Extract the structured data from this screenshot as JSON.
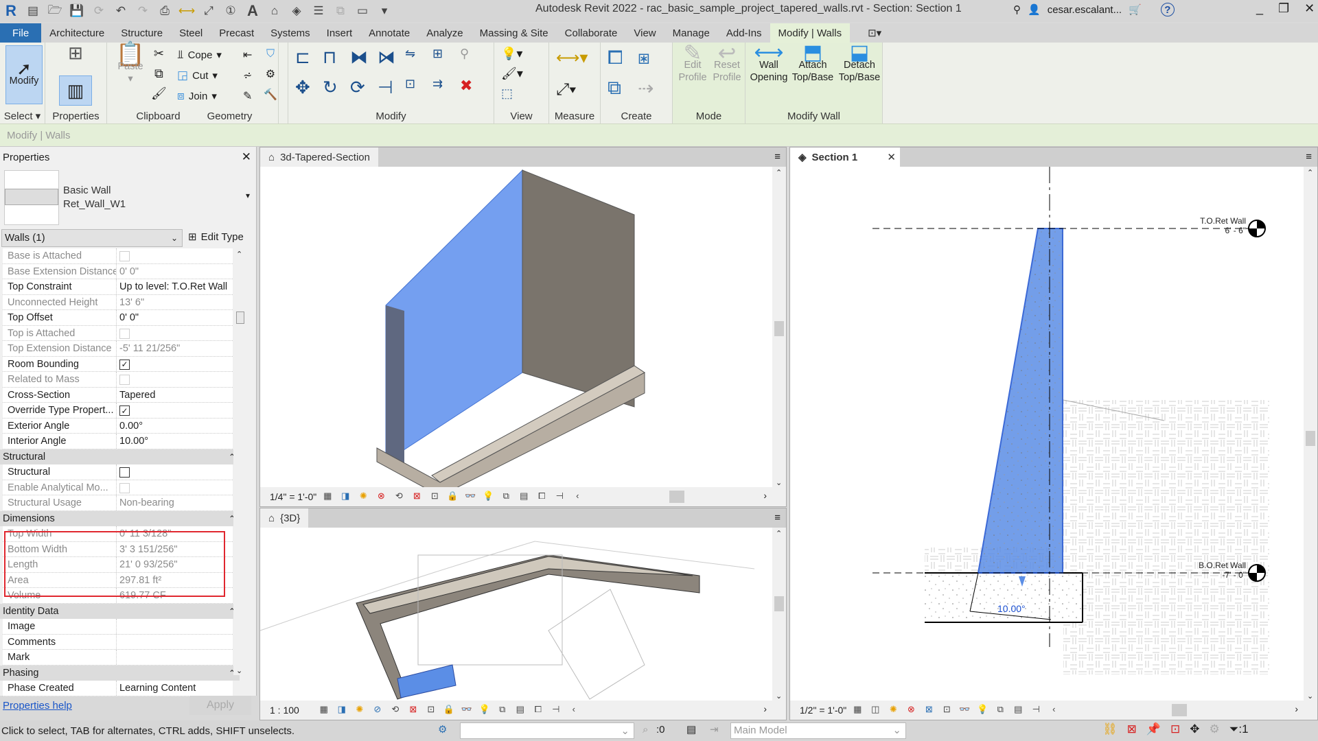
{
  "titlebar": {
    "title": "Autodesk Revit 2022 - rac_basic_sample_project_tapered_walls.rvt - Section: Section 1",
    "user": "cesar.escalant...",
    "icons": [
      "revit-logo-icon",
      "home-icon",
      "open-icon",
      "save-icon",
      "sync-icon",
      "undo-icon",
      "redo-icon",
      "print-icon",
      "measure-icon",
      "align-dimension-icon",
      "tag-icon",
      "text-icon",
      "3d-view-icon",
      "section-icon",
      "thin-lines-icon",
      "close-hidden-icon",
      "switch-windows-icon",
      "customize-qat-icon"
    ]
  },
  "ribbon_tabs": [
    "File",
    "Architecture",
    "Structure",
    "Steel",
    "Precast",
    "Systems",
    "Insert",
    "Annotate",
    "Analyze",
    "Massing & Site",
    "Collaborate",
    "View",
    "Manage",
    "Add-Ins",
    "Modify | Walls"
  ],
  "ribbon": {
    "select": {
      "button": "Modify",
      "label": "Select"
    },
    "properties": {
      "label": "Properties"
    },
    "clipboard": {
      "paste": "Paste",
      "label": "Clipboard"
    },
    "geometry": {
      "cope": "Cope",
      "cut": "Cut",
      "join": "Join",
      "label": "Geometry"
    },
    "modify": {
      "label": "Modify"
    },
    "view": {
      "label": "View"
    },
    "measure": {
      "label": "Measure"
    },
    "create": {
      "label": "Create"
    },
    "mode": {
      "edit_profile": "Edit Profile",
      "reset_profile": "Reset Profile",
      "label": "Mode"
    },
    "modify_wall": {
      "wall_opening": "Wall Opening",
      "attach": "Attach Top/Base",
      "detach": "Detach Top/Base",
      "label": "Modify Wall"
    }
  },
  "options_bar": {
    "context": "Modify | Walls"
  },
  "properties": {
    "title": "Properties",
    "type_family": "Basic Wall",
    "type_name": "Ret_Wall_W1",
    "selector": "Walls (1)",
    "edit_type": "Edit Type",
    "rows": [
      {
        "label": "Base is Attached",
        "value": "",
        "checkbox": false,
        "gray": true
      },
      {
        "label": "Base Extension Distance",
        "value": "0'  0\"",
        "gray": true
      },
      {
        "label": "Top Constraint",
        "value": "Up to level: T.O.Ret Wall",
        "gray": false
      },
      {
        "label": "Unconnected Height",
        "value": "13'  6\"",
        "gray": true
      },
      {
        "label": "Top Offset",
        "value": "0'  0\"",
        "gray": false
      },
      {
        "label": "Top is Attached",
        "value": "",
        "checkbox": false,
        "gray": true
      },
      {
        "label": "Top Extension Distance",
        "value": "-5'  11 21/256\"",
        "gray": true
      },
      {
        "label": "Room Bounding",
        "value": "",
        "checkbox": true,
        "gray": false
      },
      {
        "label": "Related to Mass",
        "value": "",
        "checkbox": false,
        "gray": true
      },
      {
        "label": "Cross-Section",
        "value": "Tapered",
        "gray": false
      },
      {
        "label": "Override Type Propert...",
        "value": "",
        "checkbox": true,
        "gray": false
      },
      {
        "label": "Exterior Angle",
        "value": "0.00°",
        "gray": false
      },
      {
        "label": "Interior Angle",
        "value": "10.00°",
        "gray": false
      }
    ],
    "structural_section": "Structural",
    "structural_rows": [
      {
        "label": "Structural",
        "value": "",
        "checkbox": false,
        "gray": false
      },
      {
        "label": "Enable Analytical Mo...",
        "value": "",
        "checkbox": false,
        "gray": true
      },
      {
        "label": "Structural Usage",
        "value": "Non-bearing",
        "gray": true
      }
    ],
    "dimensions_section": "Dimensions",
    "dimension_rows": [
      {
        "label": "Top Width",
        "value": "0'  11 3/128\""
      },
      {
        "label": "Bottom Width",
        "value": "3'  3 151/256\""
      },
      {
        "label": "Length",
        "value": "21'  0 93/256\""
      },
      {
        "label": "Area",
        "value": "297.81 ft²"
      },
      {
        "label": "Volume",
        "value": "619.77 CF"
      }
    ],
    "identity_section": "Identity Data",
    "identity_rows": [
      {
        "label": "Image",
        "value": ""
      },
      {
        "label": "Comments",
        "value": ""
      },
      {
        "label": "Mark",
        "value": ""
      }
    ],
    "phasing_section": "Phasing",
    "phasing_rows": [
      {
        "label": "Phase Created",
        "value": "Learning Content"
      }
    ],
    "help_link": "Properties help",
    "apply": "Apply"
  },
  "views": {
    "tapered": {
      "title": "3d-Tapered-Section",
      "scale": "1/4\" = 1'-0\""
    },
    "threed": {
      "title": "{3D}",
      "scale": "1 : 100"
    },
    "section": {
      "title": "Section 1",
      "scale": "1/2\" = 1'-0\"",
      "level_top": {
        "name": "T.O.Ret Wall",
        "elev": "6' - 6\""
      },
      "level_bottom": {
        "name": "B.O.Ret Wall",
        "elev": "-7' - 0\""
      },
      "angle_label": "10.00°"
    }
  },
  "statusbar": {
    "hint": "Click to select, TAB for alternates, CTRL adds, SHIFT unselects.",
    "count": ":0",
    "model": "Main Model",
    "filter": ":1"
  },
  "colors": {
    "accent": "#2a6fb3",
    "wall_blue": "#5b8ee6",
    "context_green": "#e4efd8",
    "highlight_red": "#e0262e"
  }
}
